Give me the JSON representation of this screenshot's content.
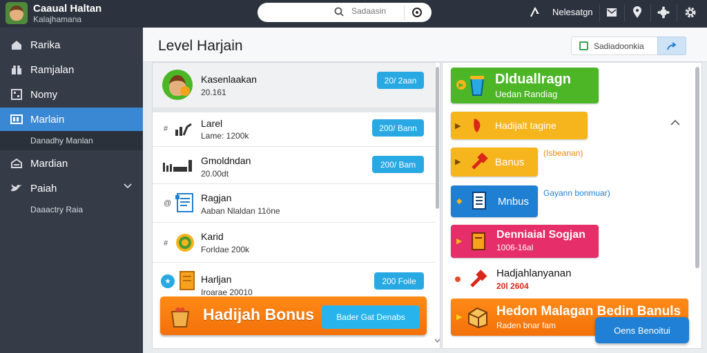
{
  "app": {
    "title": "Caaual Haltan",
    "subtitle": "Kalajhamana"
  },
  "search": {
    "placeholder": "Sadaasin"
  },
  "topbar": {
    "user_label": "Nelesatgn"
  },
  "sidebar": {
    "items": [
      {
        "label": "Rarika",
        "icon": "home-icon"
      },
      {
        "label": "Ramjalan",
        "icon": "gift-icon"
      },
      {
        "label": "Nomy",
        "icon": "grid-icon"
      },
      {
        "label": "Marlain",
        "icon": "cards-icon"
      },
      {
        "label": "Mardian",
        "icon": "inbox-icon"
      },
      {
        "label": "Paiah",
        "icon": "bird-icon"
      }
    ],
    "active_sub": "Danadhy Manlan",
    "footer_sub": "Daaactry Raia"
  },
  "header": {
    "title": "Level Harjain",
    "button_label": "Sadiadoonkia"
  },
  "list": [
    {
      "title": "Kasenlaakan",
      "sub": "20.161",
      "button": "20/ 2aan"
    },
    {
      "title": "Larel",
      "sub": "Lame: 1200k",
      "button": "200/ Bann"
    },
    {
      "title": "Gmoldndan",
      "sub": "20.00dt",
      "button": "200/ Bam"
    },
    {
      "title": "Ragjan",
      "sub": "Aaban Nlaldan 11öne",
      "button": null
    },
    {
      "title": "Karid",
      "sub": "Forldae 200k",
      "button": null
    },
    {
      "title": "Harljan",
      "sub": "Iroarae 20010",
      "button": "200 Foile"
    }
  ],
  "left_banner": {
    "title": "Hadijah Bonus",
    "button": "Bader Gat Denabs"
  },
  "cards": [
    {
      "title": "Dlduallragn",
      "sub": "Uedan Randiag",
      "color": "#4cb626"
    },
    {
      "title": "Hadijalt tagine",
      "color": "#f6b41d"
    },
    {
      "title": "Banus",
      "note": "(Isbeanan)",
      "color": "#f6b41d"
    },
    {
      "title": "Mnbus",
      "note": "Gayann bonmuar)",
      "color": "#1e7fd3"
    },
    {
      "title": "Denniaial Sogjan",
      "sub": "1006-16al",
      "color": "#e52e6a"
    },
    {
      "title": "Hadjahlanyanan",
      "sub": "20l 2604",
      "color": "#ffffff"
    },
    {
      "title": "Hedon Malagan Bedin Banuls",
      "sub": "Raden bnar fam",
      "color": "#ff7d14"
    }
  ],
  "floating_button": "Oens Benoitui"
}
